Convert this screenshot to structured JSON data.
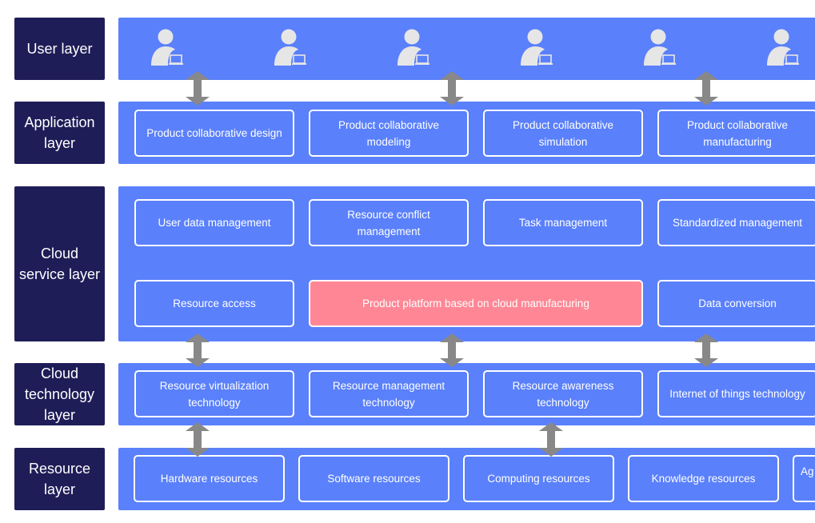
{
  "colors": {
    "layer_label_bg": "#1f1d57",
    "band_bg": "#5a80fb",
    "box_border": "#ffffff",
    "highlight_bg": "#ff8795",
    "arrow": "#888888",
    "user_icon": "#e6e6e6"
  },
  "layers": {
    "user": {
      "label": "User layer",
      "icons": [
        "user-laptop-icon",
        "user-laptop-icon",
        "user-laptop-icon",
        "user-laptop-icon",
        "user-laptop-icon",
        "user-laptop-icon"
      ]
    },
    "application": {
      "label": "Application layer",
      "boxes": [
        "Product collaborative design",
        "Product collaborative modeling",
        "Product collaborative simulation",
        "Product collaborative manufacturing"
      ]
    },
    "cloud_service": {
      "label": "Cloud service layer",
      "row1": [
        "User data management",
        "Resource conflict management",
        "Task management",
        "Standardized management"
      ],
      "row2": [
        "Resource access",
        "Product platform based on cloud manufacturing",
        "Data conversion"
      ]
    },
    "cloud_technology": {
      "label": "Cloud technology layer",
      "boxes": [
        "Resource virtualization technology",
        "Resource management technology",
        "Resource awareness technology",
        "Internet of things technology"
      ]
    },
    "resource": {
      "label": "Resource layer",
      "boxes": [
        "Hardware resources",
        "Software resources",
        "Computing resources",
        "Knowledge resources",
        "Ag"
      ]
    }
  },
  "connectors": {
    "type": "bidirectional-arrow",
    "user_to_application": 3,
    "service_to_technology": 3,
    "technology_to_resource": 2
  }
}
